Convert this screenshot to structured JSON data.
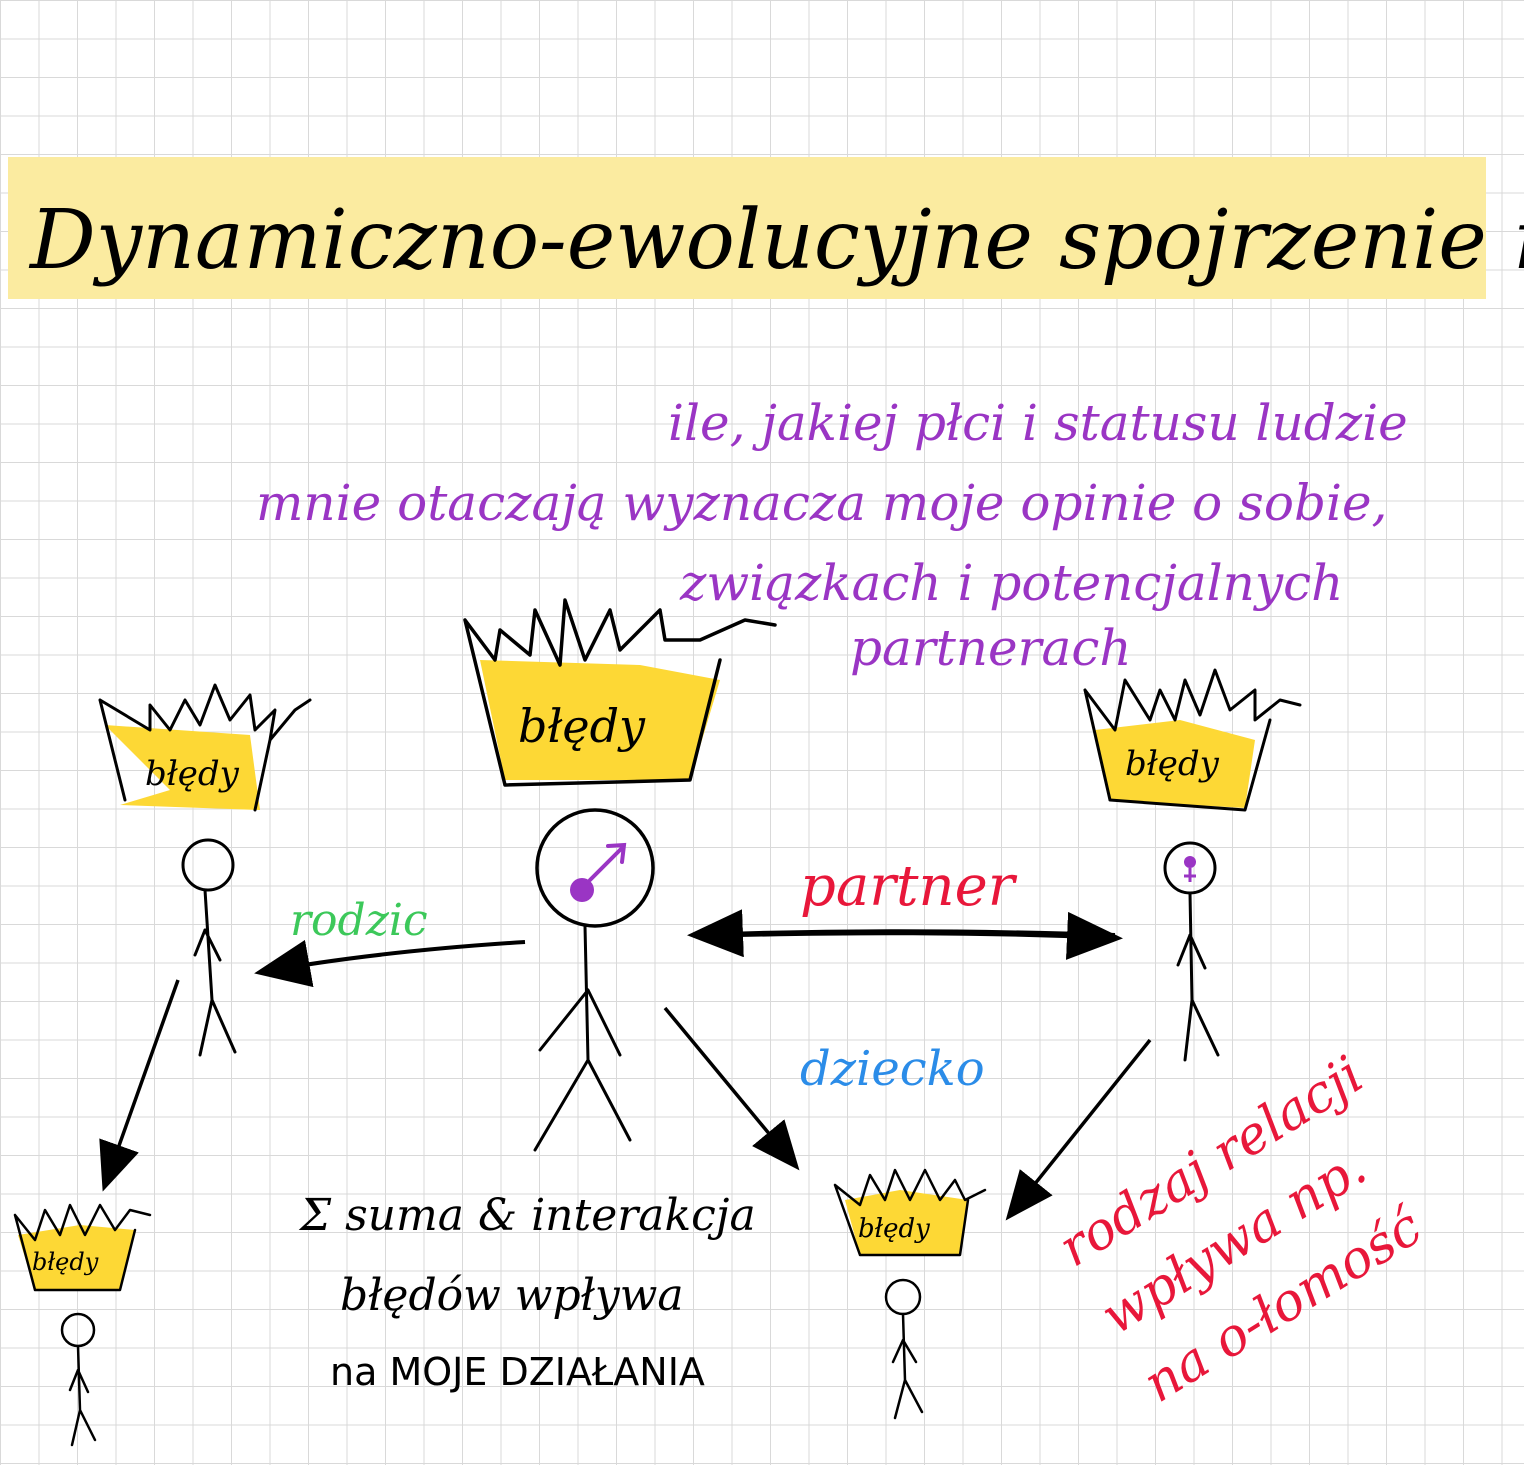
{
  "title": "Dynamiczno-ewolucyjne spojrzenie na miłość",
  "subtitle_lines": [
    "ile, jakiej płci i statusu ludzie",
    "mnie otaczają wyznacza moje opinie o sobie,",
    "związkach i potencjalnych",
    "partnerach"
  ],
  "crown_label": "błędy",
  "relations": {
    "parent": "rodzic",
    "partner": "partner",
    "child": "dziecko"
  },
  "sum_note_lines": [
    "Σ suma & interakcja",
    "błędów wpływa",
    "na MOJE DZIAŁANIA"
  ],
  "relation_note_lines": [
    "rodzaj relacji",
    "wpływa np.",
    "na o-łomość"
  ],
  "colors": {
    "highlight": "#fbeba0",
    "crown_fill": "#fdd835",
    "subtitle": "#9a35c4",
    "parent": "#3cc85a",
    "partner": "#e8173a",
    "child": "#2b8ce8",
    "note": "#e8173a",
    "ink": "#000000"
  }
}
